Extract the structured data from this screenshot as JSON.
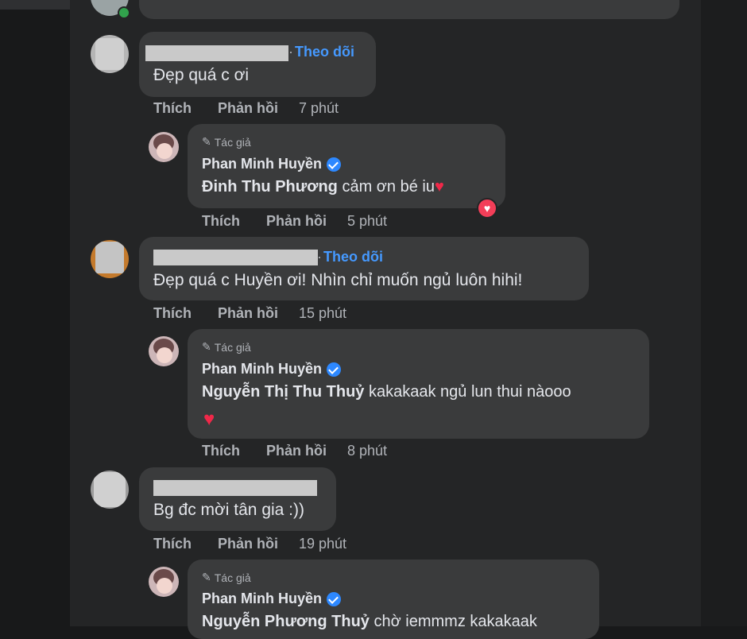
{
  "colors": {
    "accent": "#4599ff",
    "background": "#242526",
    "bubble": "#3a3b3c",
    "heart": "#f02849",
    "verified": "#2d88ff",
    "online": "#31a24c"
  },
  "common": {
    "follow_label": "Theo dõi",
    "like_label": "Thích",
    "reply_label": "Phản hồi",
    "author_tag": "Tác giả",
    "author_name": "Phan Minh Huyền",
    "heart_glyph": "♥",
    "badge_icon": "heart-reaction-icon"
  },
  "threads": [
    {
      "comment": {
        "text": "Đẹp quá c ơi",
        "time": "7 phút"
      },
      "reply": {
        "mention": "Đinh Thu Phương",
        "text": " cảm ơn bé iu",
        "time": "5 phút"
      }
    },
    {
      "comment": {
        "text": "Đẹp quá c Huyền ơi! Nhìn chỉ muốn ngủ luôn hihi!",
        "time": "15 phút"
      },
      "reply": {
        "mention": "Nguyễn Thị Thu Thuỷ",
        "text": " kakakaak ngủ lun thui nàooo",
        "time": "8 phút"
      }
    },
    {
      "comment": {
        "text": "Bg đc mời tân gia :))",
        "time": "19 phút"
      },
      "reply": {
        "mention": "Nguyễn Phương Thuỷ",
        "text": " chờ iemmmz kakakaak"
      }
    }
  ]
}
